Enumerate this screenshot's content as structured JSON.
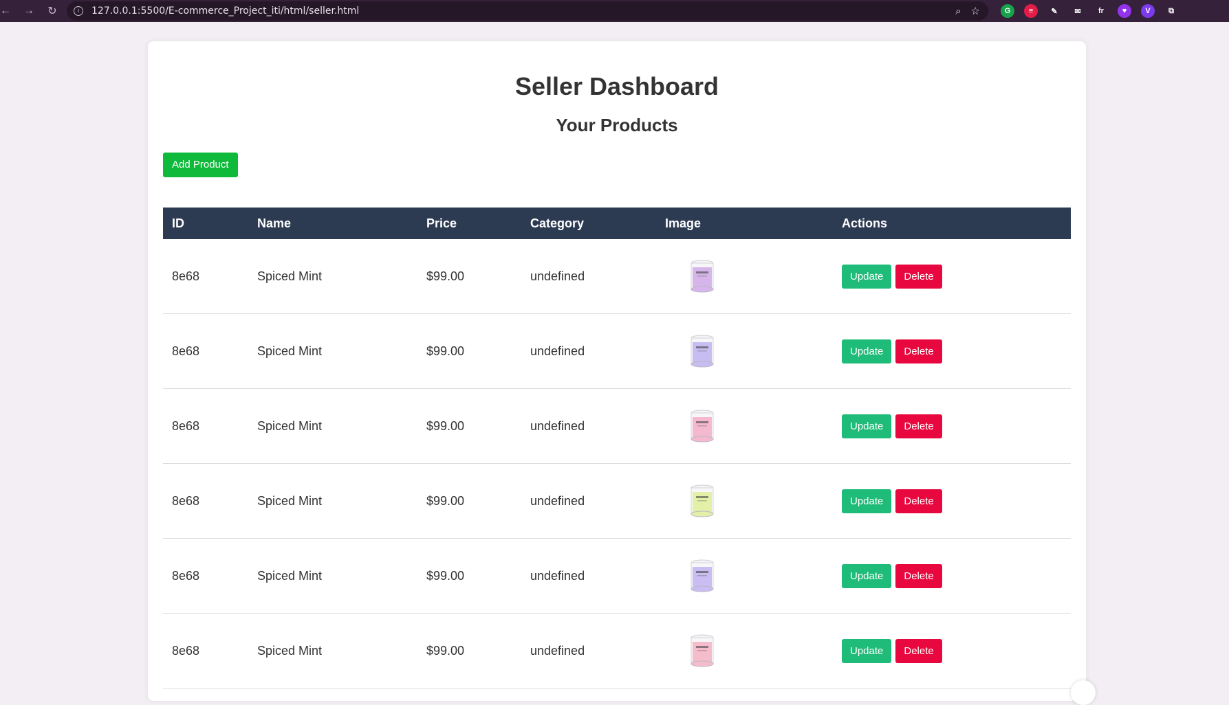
{
  "browser": {
    "url": "127.0.0.1:5500/E-commerce_Project_iti/html/seller.html",
    "extensions": [
      {
        "name": "grammarly-icon",
        "color": "#17a34a",
        "glyph": "G"
      },
      {
        "name": "lastpass-icon",
        "color": "#e11d48",
        "glyph": "≡"
      },
      {
        "name": "pen-icon",
        "color": "#35213a",
        "glyph": "✎"
      },
      {
        "name": "mail-icon",
        "color": "#35213a",
        "glyph": "✉"
      },
      {
        "name": "fx-icon",
        "color": "#35213a",
        "glyph": "fr"
      },
      {
        "name": "heart-extension-icon",
        "color": "#9333ea",
        "glyph": "♥"
      },
      {
        "name": "v-extension-icon",
        "color": "#7c3aed",
        "glyph": "V"
      },
      {
        "name": "puzzle-icon",
        "color": "#35213a",
        "glyph": "⧉"
      }
    ]
  },
  "page": {
    "title": "Seller Dashboard",
    "subtitle": "Your Products",
    "add_button": "Add Product"
  },
  "table": {
    "headers": [
      "ID",
      "Name",
      "Price",
      "Category",
      "Image",
      "Actions"
    ],
    "rows": [
      {
        "id": "8e68",
        "name": "Spiced Mint",
        "price": "$99.00",
        "category": "undefined",
        "candle_color": "#d6b6ea"
      },
      {
        "id": "8e68",
        "name": "Spiced Mint",
        "price": "$99.00",
        "category": "undefined",
        "candle_color": "#c7bdf0"
      },
      {
        "id": "8e68",
        "name": "Spiced Mint",
        "price": "$99.00",
        "category": "undefined",
        "candle_color": "#f5b9cf"
      },
      {
        "id": "8e68",
        "name": "Spiced Mint",
        "price": "$99.00",
        "category": "undefined",
        "candle_color": "#e2f0a8"
      },
      {
        "id": "8e68",
        "name": "Spiced Mint",
        "price": "$99.00",
        "category": "undefined",
        "candle_color": "#c9bdf1"
      },
      {
        "id": "8e68",
        "name": "Spiced Mint",
        "price": "$99.00",
        "category": "undefined",
        "candle_color": "#f5bccc"
      }
    ],
    "update_label": "Update",
    "delete_label": "Delete"
  },
  "colors": {
    "add_button": "#0fba3a",
    "update_button": "#1fbb78",
    "delete_button": "#e8073e",
    "table_header": "#2c3a52"
  }
}
